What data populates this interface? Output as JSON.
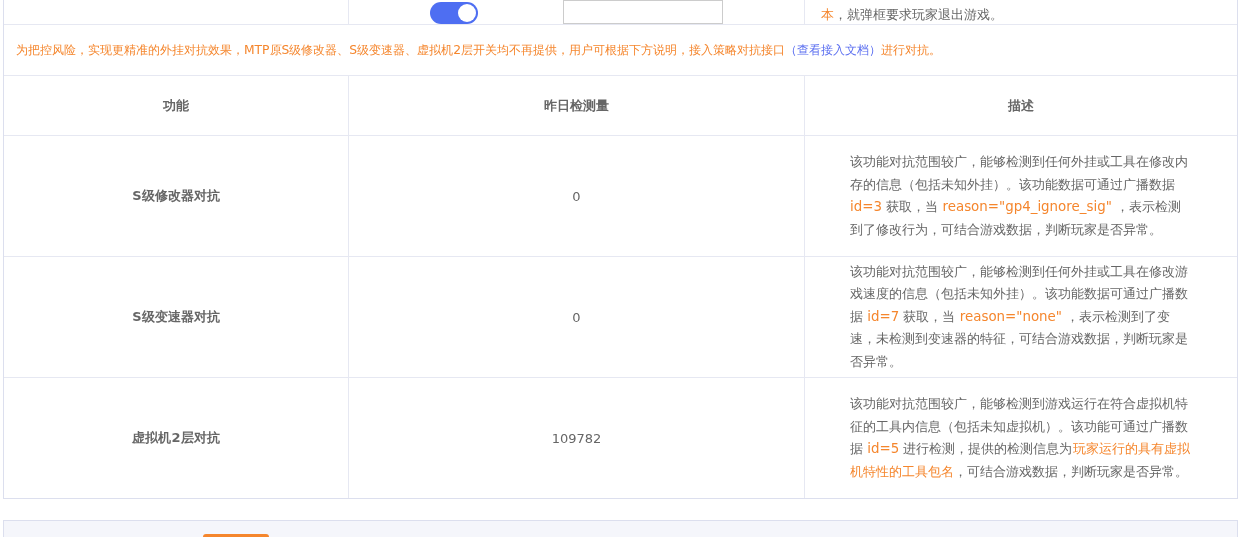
{
  "top_row": {
    "toggle": {
      "on": true
    },
    "description": [
      {
        "text": "本",
        "highlight": true
      },
      {
        "text": "，就弹框要求玩家退出游戏。",
        "highlight": false
      }
    ]
  },
  "notice": [
    {
      "text": "为把控风险，实现更精准的外挂对抗效果，MTP原S级修改器、S级变速器、虚拟机2层开关均不再提供，用户可根据下方说明，接入策略对抗接口",
      "kind": "text"
    },
    {
      "text": "（查看接入文档）",
      "kind": "link"
    },
    {
      "text": "进行对抗。",
      "kind": "text"
    }
  ],
  "table": {
    "columns": [
      "功能",
      "昨日检测量",
      "描述"
    ],
    "rows": [
      {
        "feature": "S级修改器对抗",
        "count": "0",
        "description": [
          {
            "text": "该功能对抗范围较广，能够检测到任何外挂或工具在修改内存的信息（包括未知外挂）。该功能数据可通过广播数据 ",
            "highlight": false
          },
          {
            "text": "id=3",
            "highlight": true
          },
          {
            "text": " 获取，当 ",
            "highlight": false
          },
          {
            "text": "reason=\"gp4_ignore_sig\"",
            "highlight": true
          },
          {
            "text": " ，表示检测到了修改行为，可结合游戏数据，判断玩家是否异常。",
            "highlight": false
          }
        ]
      },
      {
        "feature": "S级变速器对抗",
        "count": "0",
        "description": [
          {
            "text": "该功能对抗范围较广，能够检测到任何外挂或工具在修改游戏速度的信息（包括未知外挂）。该功能数据可通过广播数据 ",
            "highlight": false
          },
          {
            "text": "id=7",
            "highlight": true
          },
          {
            "text": " 获取，当 ",
            "highlight": false
          },
          {
            "text": "reason=\"none\"",
            "highlight": true
          },
          {
            "text": " ，表示检测到了变速，未检测到变速器的特征，可结合游戏数据，判断玩家是否异常。",
            "highlight": false
          }
        ]
      },
      {
        "feature": "虚拟机2层对抗",
        "count": "109782",
        "description": [
          {
            "text": "该功能对抗范围较广，能够检测到游戏运行在符合虚拟机特征的工具内信息（包括未知虚拟机）。该功能可通过广播数据 ",
            "highlight": false
          },
          {
            "text": "id=5",
            "highlight": true
          },
          {
            "text": " 进行检测，提供的检测信息为",
            "highlight": false
          },
          {
            "text": "玩家运行的具有虚拟机特性的工具包名",
            "highlight": true
          },
          {
            "text": "，可结合游戏数据，判断玩家是否异常。",
            "highlight": false
          }
        ]
      }
    ]
  }
}
